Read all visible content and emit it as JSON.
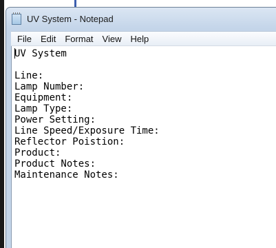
{
  "window": {
    "title": "UV System - Notepad",
    "icon": "notepad-icon"
  },
  "menu": {
    "items": [
      "File",
      "Edit",
      "Format",
      "View",
      "Help"
    ]
  },
  "editor": {
    "lines": [
      "UV System",
      "",
      "Line:",
      "Lamp Number:",
      "Equipment:",
      "Lamp Type:",
      "Power Setting:",
      "Line Speed/Exposure Time:",
      "Reflector Poistion:",
      "Product:",
      "Product Notes:",
      "Maintenance Notes:"
    ]
  }
}
